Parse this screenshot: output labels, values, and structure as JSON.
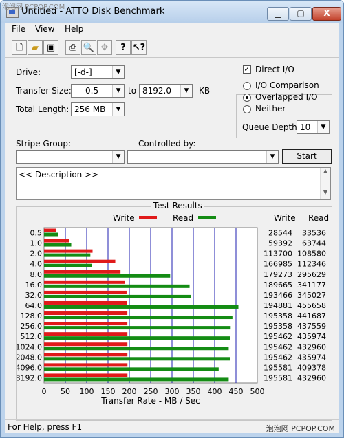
{
  "window": {
    "title": "Untitled - ATTO Disk Benchmark",
    "watermark_top": "泡泡网 PCPOP.COM"
  },
  "titlebar_buttons": {
    "minimize": "▁",
    "maximize": "▢",
    "close": "X"
  },
  "menu": [
    "File",
    "View",
    "Help"
  ],
  "toolbar": [
    "new-icon",
    "open-icon",
    "save-icon",
    "print-icon",
    "print-preview-icon",
    "move-icon",
    "help-icon",
    "context-help-icon"
  ],
  "form": {
    "drive_label": "Drive:",
    "drive_value": "[-d-]",
    "transfer_size_label": "Transfer Size:",
    "transfer_from": "0.5",
    "to_label": "to",
    "transfer_to": "8192.0",
    "kb_label": "KB",
    "total_length_label": "Total Length:",
    "total_length_value": "256 MB",
    "direct_io_label": "Direct I/O",
    "direct_io_checked": "✓",
    "io_comparison_label": "I/O Comparison",
    "overlapped_io_label": "Overlapped I/O",
    "neither_label": "Neither",
    "queue_depth_label": "Queue Depth:",
    "queue_depth_value": "10",
    "stripe_group_label": "Stripe Group:",
    "stripe_group_value": "",
    "controlled_by_label": "Controlled by:",
    "controlled_by_value": "",
    "start_label": "Start",
    "description": "<< Description >>"
  },
  "results": {
    "legend_title": "Test Results",
    "write_header": "Write",
    "read_header": "Read"
  },
  "chart_data": {
    "type": "bar",
    "orientation": "horizontal",
    "categories": [
      "0.5",
      "1.0",
      "2.0",
      "4.0",
      "8.0",
      "16.0",
      "32.0",
      "64.0",
      "128.0",
      "256.0",
      "512.0",
      "1024.0",
      "2048.0",
      "4096.0",
      "8192.0"
    ],
    "series": [
      {
        "name": "Write",
        "color": "#e01a1a",
        "values": [
          28.544,
          59.392,
          113.7,
          166.985,
          179.273,
          189.665,
          193.466,
          194.881,
          195.358,
          195.358,
          195.462,
          195.462,
          195.462,
          195.581,
          195.581
        ],
        "labels": [
          "28544",
          "59392",
          "113700",
          "166985",
          "179273",
          "189665",
          "193466",
          "194881",
          "195358",
          "195358",
          "195462",
          "195462",
          "195462",
          "195581",
          "195581"
        ]
      },
      {
        "name": "Read",
        "color": "#148c14",
        "values": [
          33.536,
          63.744,
          108.58,
          112.346,
          295.629,
          341.177,
          345.027,
          455.658,
          441.687,
          437.559,
          435.974,
          432.96,
          435.974,
          409.378,
          432.96
        ],
        "labels": [
          "33536",
          "63744",
          "108580",
          "112346",
          "295629",
          "341177",
          "345027",
          "455658",
          "441687",
          "437559",
          "435974",
          "432960",
          "435974",
          "409378",
          "432960"
        ]
      }
    ],
    "xlabel": "Transfer Rate - MB / Sec",
    "xlim": [
      0,
      500
    ],
    "xticks": [
      "0",
      "50",
      "100",
      "150",
      "200",
      "250",
      "300",
      "350",
      "400",
      "450",
      "500"
    ],
    "grid": true,
    "gridline_color": "#1f1fb0",
    "legend_placement": "top"
  },
  "status": {
    "text": "For Help, press F1",
    "watermark": "泡泡网 PCPOP.COM"
  }
}
